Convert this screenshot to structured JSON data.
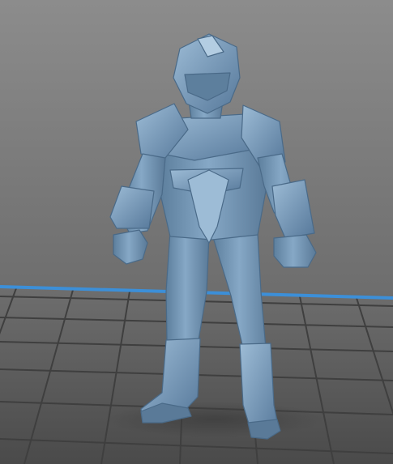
{
  "viewport": {
    "background_top": "#8a8a8a",
    "background_bottom": "#4e4e4e",
    "grid_line_color": "#3a3a3a",
    "axis_color": "#3c8fd8",
    "model_color": "#7da0be",
    "model_shadow": "#4d6e8c",
    "model_highlight": "#b3cde2"
  },
  "model": {
    "name": "armored-figure-model"
  }
}
